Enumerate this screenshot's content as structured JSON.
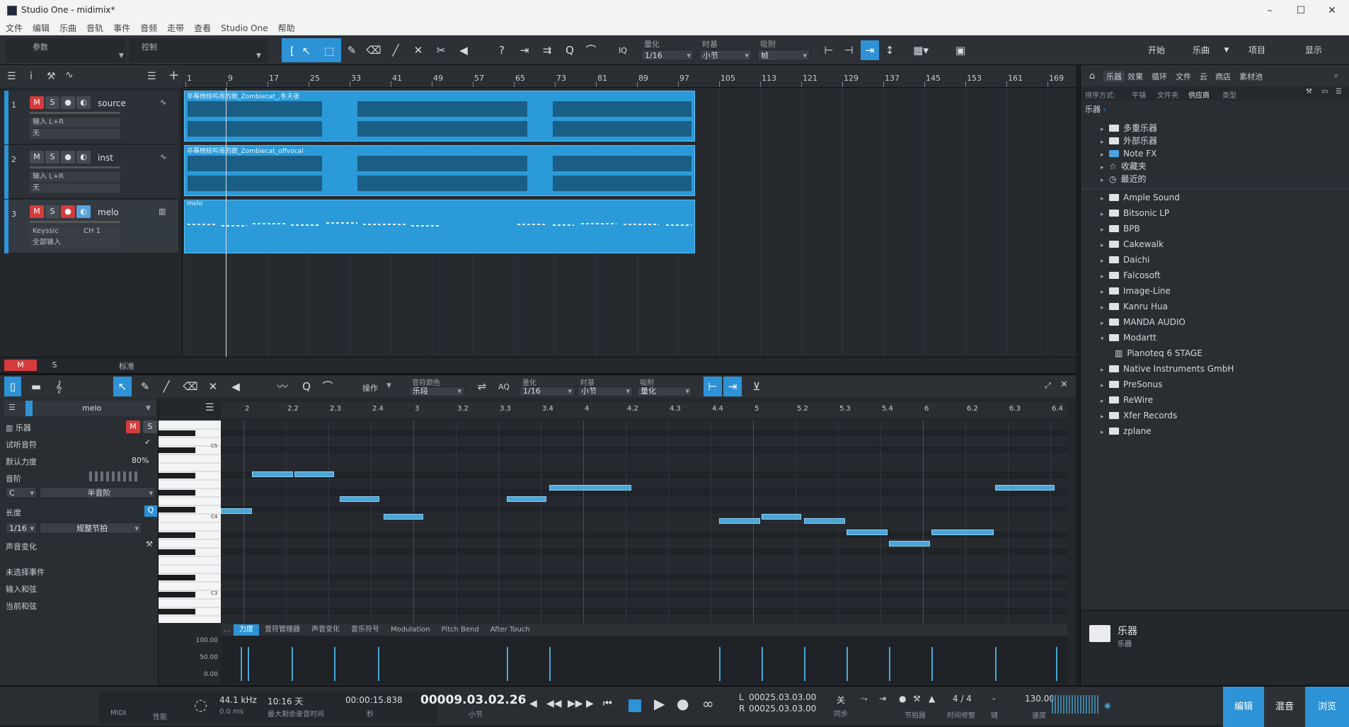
{
  "window": {
    "title": "Studio One - midimix*"
  },
  "menu": [
    "文件",
    "编辑",
    "乐曲",
    "音轨",
    "事件",
    "音频",
    "走带",
    "查看",
    "Studio One",
    "帮助"
  ],
  "toolbar": {
    "left_label_1": "参数",
    "left_label_2": "控制",
    "quantize_label": "量化",
    "quantize_value": "1/16",
    "timebase_label": "时基",
    "timebase_value": "小节",
    "snap_label": "吸附",
    "snap_value": "帧",
    "iq": "IQ",
    "nav": {
      "start": "开始",
      "song": "乐曲",
      "project": "项目",
      "show": "显示"
    }
  },
  "arrange": {
    "ruler": [
      "1",
      "9",
      "17",
      "25",
      "33",
      "41",
      "49",
      "57",
      "65",
      "73",
      "81",
      "89",
      "97",
      "105",
      "113",
      "121",
      "129",
      "137",
      "145",
      "153",
      "161",
      "169"
    ],
    "tracks": [
      {
        "num": "1",
        "name": "source",
        "io1": "输入 L+R",
        "io2": "无",
        "clip": "卒蓦榜枝鸣哥的歌_Zombiecat_,冬天夜"
      },
      {
        "num": "2",
        "name": "inst",
        "io1": "输入 L+R",
        "io2": "无",
        "clip": "卒蓦榜枝鸣哥的歌_Zombiecat_offvocal"
      },
      {
        "num": "3",
        "name": "melo",
        "io1": "Keyssic",
        "io1b": "CH 1",
        "io2": "全部输入",
        "clip": "melo"
      }
    ],
    "m": "M",
    "s": "S",
    "bottom": {
      "m": "M",
      "s": "S",
      "zoom": "标准"
    }
  },
  "browser": {
    "tabs": [
      "乐器",
      "效果",
      "循环",
      "文件",
      "云",
      "商店",
      "素材池"
    ],
    "sort_label": "排序方式:",
    "sort_options": [
      "平铺",
      "文件夹",
      "供应商",
      "类型"
    ],
    "crumb": "乐器",
    "items": [
      {
        "label": "多重乐器"
      },
      {
        "label": "外部乐器"
      },
      {
        "label": "Note FX"
      },
      {
        "label": "收藏夹"
      },
      {
        "label": "最近的"
      },
      {
        "label": "Ample Sound"
      },
      {
        "label": "Bitsonic LP"
      },
      {
        "label": "BPB"
      },
      {
        "label": "Cakewalk"
      },
      {
        "label": "Daichi"
      },
      {
        "label": "Falcosoft"
      },
      {
        "label": "Image-Line"
      },
      {
        "label": "Kanru Hua"
      },
      {
        "label": "MANDA AUDIO"
      },
      {
        "label": "Modartt"
      },
      {
        "label": "Pianoteq 6 STAGE"
      },
      {
        "label": "Native Instruments GmbH"
      },
      {
        "label": "PreSonus"
      },
      {
        "label": "ReWire"
      },
      {
        "label": "Xfer Records"
      },
      {
        "label": "zplane"
      }
    ],
    "footer_title": "乐器",
    "footer_sub": "乐器"
  },
  "editor": {
    "ops_label": "操作",
    "color_label": "音符颜色",
    "color_value": "乐段",
    "aq": "AQ",
    "quantize_label": "量化",
    "quantize_value": "1/16",
    "timebase_label": "时基",
    "timebase_value": "小节",
    "snap_label": "吸附",
    "snap_value": "量化",
    "track_name": "melo",
    "inspector": {
      "instrument": "乐器",
      "m": "M",
      "s": "S",
      "audition": "试听音符",
      "velocity_label": "默认力度",
      "velocity_value": "80%",
      "scale_label": "音阶",
      "key": "C",
      "scale": "半音阶",
      "length_label": "长度",
      "length_value": "1/16",
      "length_mode": "规整节拍",
      "pitch_label": "声音变化",
      "no_event": "未选择事件",
      "input_chord": "输入和弦",
      "current_chord": "当前和弦"
    },
    "ruler": [
      "2",
      "2.2",
      "2.3",
      "2.4",
      "3",
      "3.2",
      "3.3",
      "3.4",
      "4",
      "4.2",
      "4.3",
      "4.4",
      "5",
      "5.2",
      "5.3",
      "5.4",
      "6",
      "6.2",
      "6.3",
      "6.4"
    ],
    "piano_labels": [
      "C5",
      "C4",
      "C3"
    ],
    "lane_tabs": [
      "力度",
      "音符管理器",
      "声音变化",
      "音乐符号",
      "Modulation",
      "Pitch Bend",
      "After Touch"
    ],
    "vel_scale": [
      "100.00",
      "50.00",
      "0.00"
    ]
  },
  "transport": {
    "midi": "MIDI",
    "perf": "性能",
    "sample_rate": "44.1 kHz",
    "latency": "0.0 ms",
    "record_time": "10:16 天",
    "record_time_label": "最大剩余录音时间",
    "seconds": "00:00:15.838",
    "seconds_label": "秒",
    "position": "00009.03.02.26",
    "position_label": "小节",
    "loop_l": "L",
    "loop_r": "R",
    "loop_start": "00025.03.03.00",
    "loop_end": "00025.03.03.00",
    "sync": "关",
    "sync_label": "同步",
    "metronome_label": "节拍器",
    "time_sig": "4 / 4",
    "time_sig_label": "时间修整",
    "key_value": "-",
    "key_label": "键",
    "tempo": "130.00",
    "tempo_label": "速度",
    "nav": {
      "edit": "编辑",
      "mix": "混音",
      "browse": "浏览"
    }
  },
  "colors": {
    "accent": "#2e92d6",
    "clip": "#2b9ad8",
    "mute": "#d43b3b"
  }
}
